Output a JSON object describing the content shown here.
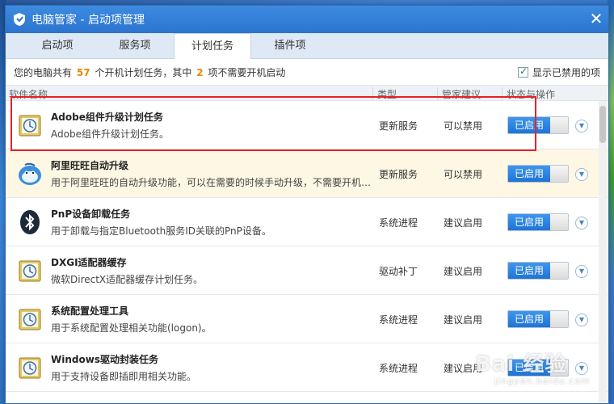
{
  "window": {
    "title": "电脑管家 - 启动项管理",
    "close_label": "✕"
  },
  "tabs": [
    {
      "label": "启动项"
    },
    {
      "label": "服务项"
    },
    {
      "label": "计划任务"
    },
    {
      "label": "插件项"
    }
  ],
  "info": {
    "prefix": "您的电脑共有",
    "total": "57",
    "middle": "个开机计划任务，其中",
    "unneeded": "2",
    "suffix": "项不需要开机启动",
    "show_disabled_label": "显示已禁用的项"
  },
  "columns": {
    "name": "软件名称",
    "type": "类型",
    "advice": "管家建议",
    "status": "状态与操作"
  },
  "rows": [
    {
      "name": "Adobe组件升级计划任务",
      "desc": "Adobe组件升级计划任务。",
      "type": "更新服务",
      "advice": "可以禁用",
      "status": "已启用",
      "icon": "scheduler-icon"
    },
    {
      "name": "阿里旺旺自动升级",
      "desc": "用于阿里旺旺的自动升级功能，可以在需要的时候手动升级，不需要开机自动升级",
      "type": "更新服务",
      "advice": "可以禁用",
      "status": "已启用",
      "icon": "wangwang-icon"
    },
    {
      "name": "PnP设备卸载任务",
      "desc": "用于卸载与指定Bluetooth服务ID关联的PnP设备。",
      "type": "系统进程",
      "advice": "建议启用",
      "status": "已启用",
      "icon": "bluetooth-icon"
    },
    {
      "name": "DXGI适配器缓存",
      "desc": "微软DirectX适配器缓存计划任务。",
      "type": "驱动补丁",
      "advice": "建议启用",
      "status": "已启用",
      "icon": "scheduler-icon"
    },
    {
      "name": "系统配置处理工具",
      "desc": "用于系统配置处理相关功能(logon)。",
      "type": "系统进程",
      "advice": "建议启用",
      "status": "已启用",
      "icon": "scheduler-icon"
    },
    {
      "name": "Windows驱动封装任务",
      "desc": "用于支持设备即插即用相关功能。",
      "type": "系统进程",
      "advice": "建议启用",
      "status": "已启用",
      "icon": "scheduler-icon"
    }
  ],
  "watermark": {
    "text": "Bai 经验",
    "sub": "jingyan.baidu.com"
  }
}
